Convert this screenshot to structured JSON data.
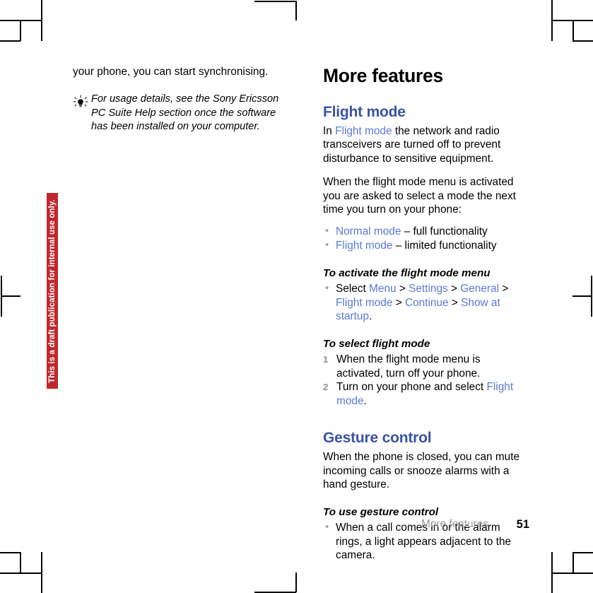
{
  "document": {
    "watermark": "This is a draft publication for internal use only.",
    "watermark_color": "#c1272d",
    "heading_color": "#3a53a4",
    "link_color": "#5b79d6"
  },
  "left_column": {
    "continued_paragraph": "your phone, you can start synchronising.",
    "tip": {
      "icon": "lightbulb-tip-icon",
      "text": "For usage details, see the Sony Ericsson PC Suite Help section once the software has been installed on your computer."
    }
  },
  "right_column": {
    "chapter_title": "More features",
    "sections": [
      {
        "id": "flight-mode",
        "title": "Flight mode",
        "paragraph_1": {
          "before": "In ",
          "link": "Flight mode",
          "after": " the network and radio transceivers are turned off to prevent disturbance to sensitive equipment."
        },
        "paragraph_2": "When the flight mode menu is activated you are asked to select a mode the next time you turn on your phone:",
        "mode_bullets": [
          {
            "link": "Normal mode",
            "rest": " – full functionality"
          },
          {
            "link": "Flight mode",
            "rest": " – limited functionality"
          }
        ],
        "procedure_1": {
          "title": "To activate the flight mode menu",
          "lead": "Select ",
          "path": [
            "Menu",
            "Settings",
            "General",
            "Flight mode",
            "Continue",
            "Show at startup"
          ],
          "separator": " > ",
          "terminator": "."
        },
        "procedure_2": {
          "title": "To select flight mode",
          "steps": [
            {
              "text": "When the flight mode menu is activated, turn off your phone."
            },
            {
              "before": "Turn on your phone and select ",
              "link": "Flight mode",
              "after": "."
            }
          ]
        }
      },
      {
        "id": "gesture-control",
        "title": "Gesture control",
        "paragraph_1": "When the phone is closed, you can mute incoming calls or snooze alarms with a hand gesture.",
        "procedure_1": {
          "title": "To use gesture control",
          "bullets": [
            "When a call comes in or the alarm rings, a light appears adjacent to the camera."
          ]
        }
      }
    ]
  },
  "footer": {
    "section_name": "More features",
    "page_number": "51"
  }
}
